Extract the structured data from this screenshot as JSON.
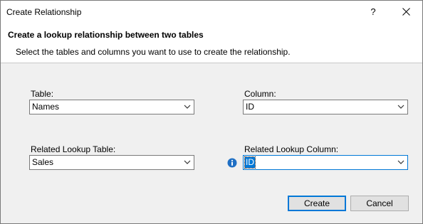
{
  "window": {
    "title": "Create Relationship",
    "help_label": "?"
  },
  "header": {
    "title": "Create a lookup relationship between two tables",
    "subtitle": "Select the tables and columns you want to use to create the relationship."
  },
  "form": {
    "table_label": "Table:",
    "table_value": "Names",
    "column_label": "Column:",
    "column_value": "ID",
    "related_table_label": "Related Lookup Table:",
    "related_table_value": "Sales",
    "related_column_label": "Related Lookup Column:",
    "related_column_value": "ID"
  },
  "buttons": {
    "create_label": "Create",
    "cancel_label": "Cancel"
  },
  "colors": {
    "accent": "#0078d7",
    "info_icon": "#1f6fc4"
  },
  "icons": {
    "close": "close-icon",
    "dropdown": "chevron-down-icon",
    "info": "info-icon"
  }
}
